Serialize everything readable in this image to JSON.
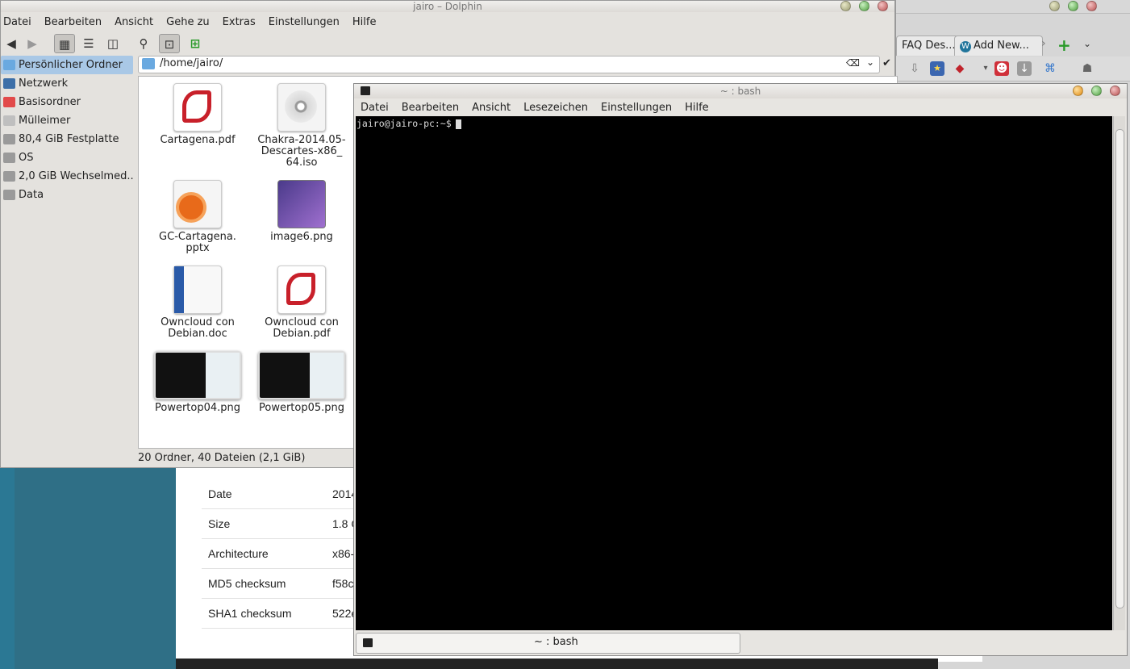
{
  "dolphin": {
    "title": "jairo – Dolphin",
    "menu": [
      "Datei",
      "Bearbeiten",
      "Ansicht",
      "Gehe zu",
      "Extras",
      "Einstellungen",
      "Hilfe"
    ],
    "places": [
      {
        "label": "Persönlicher Ordner",
        "color": "#6aa9e0"
      },
      {
        "label": "Netzwerk",
        "color": "#3d6fa8"
      },
      {
        "label": "Basisordner",
        "color": "#e24a4a"
      },
      {
        "label": "Mülleimer",
        "color": "#bfbfbf"
      },
      {
        "label": "80,4 GiB Festplatte",
        "color": "#9a9a9a"
      },
      {
        "label": "OS",
        "color": "#9a9a9a"
      },
      {
        "label": "2,0 GiB Wechselmed...",
        "color": "#9a9a9a"
      },
      {
        "label": "Data",
        "color": "#9a9a9a"
      }
    ],
    "path": "/home/jairo/",
    "files": [
      {
        "name": "Cartagena.pdf",
        "icon": "pdf-icon"
      },
      {
        "name": "Chakra-2014.05-Descartes-x86_64.iso",
        "icon": "disc-icon",
        "lines": [
          "Chakra-2014.05-",
          "Descartes-x86_",
          "64.iso"
        ]
      },
      {
        "name": "GC-Cartagena.pptx",
        "icon": "presentation-icon",
        "lines": [
          "GC-Cartagena.",
          "pptx"
        ]
      },
      {
        "name": "image6.png",
        "icon": "png-icon"
      },
      {
        "name": "Owncloud con Debian.doc",
        "icon": "word-doc-icon",
        "lines": [
          "Owncloud con",
          "Debian.doc"
        ]
      },
      {
        "name": "Owncloud con Debian.pdf",
        "icon": "pdf-icon",
        "lines": [
          "Owncloud con",
          "Debian.pdf"
        ]
      },
      {
        "name": "Powertop04.png",
        "icon": "screenshot-thumb"
      },
      {
        "name": "Powertop05.png",
        "icon": "screenshot-thumb"
      }
    ],
    "status": "20 Ordner, 40 Dateien (2,1 GiB)"
  },
  "konsole": {
    "title": "~ : bash",
    "menu": [
      "Datei",
      "Bearbeiten",
      "Ansicht",
      "Lesezeichen",
      "Einstellungen",
      "Hilfe"
    ],
    "prompt": "jairo@jairo-pc:~$",
    "tab_label": "~ : bash"
  },
  "browser": {
    "tabs": [
      "FAQ Des...",
      "Add New..."
    ]
  },
  "webpage": {
    "rows": [
      {
        "key": "Date",
        "value": "2014"
      },
      {
        "key": "Size",
        "value": "1.8 G"
      },
      {
        "key": "Architecture",
        "value": "x86-"
      },
      {
        "key": "MD5 checksum",
        "value": "f58c"
      },
      {
        "key": "SHA1 checksum",
        "value": "522e"
      }
    ]
  },
  "colors": {
    "accent": "#a9c8e6",
    "terminal_bg": "#000000"
  }
}
